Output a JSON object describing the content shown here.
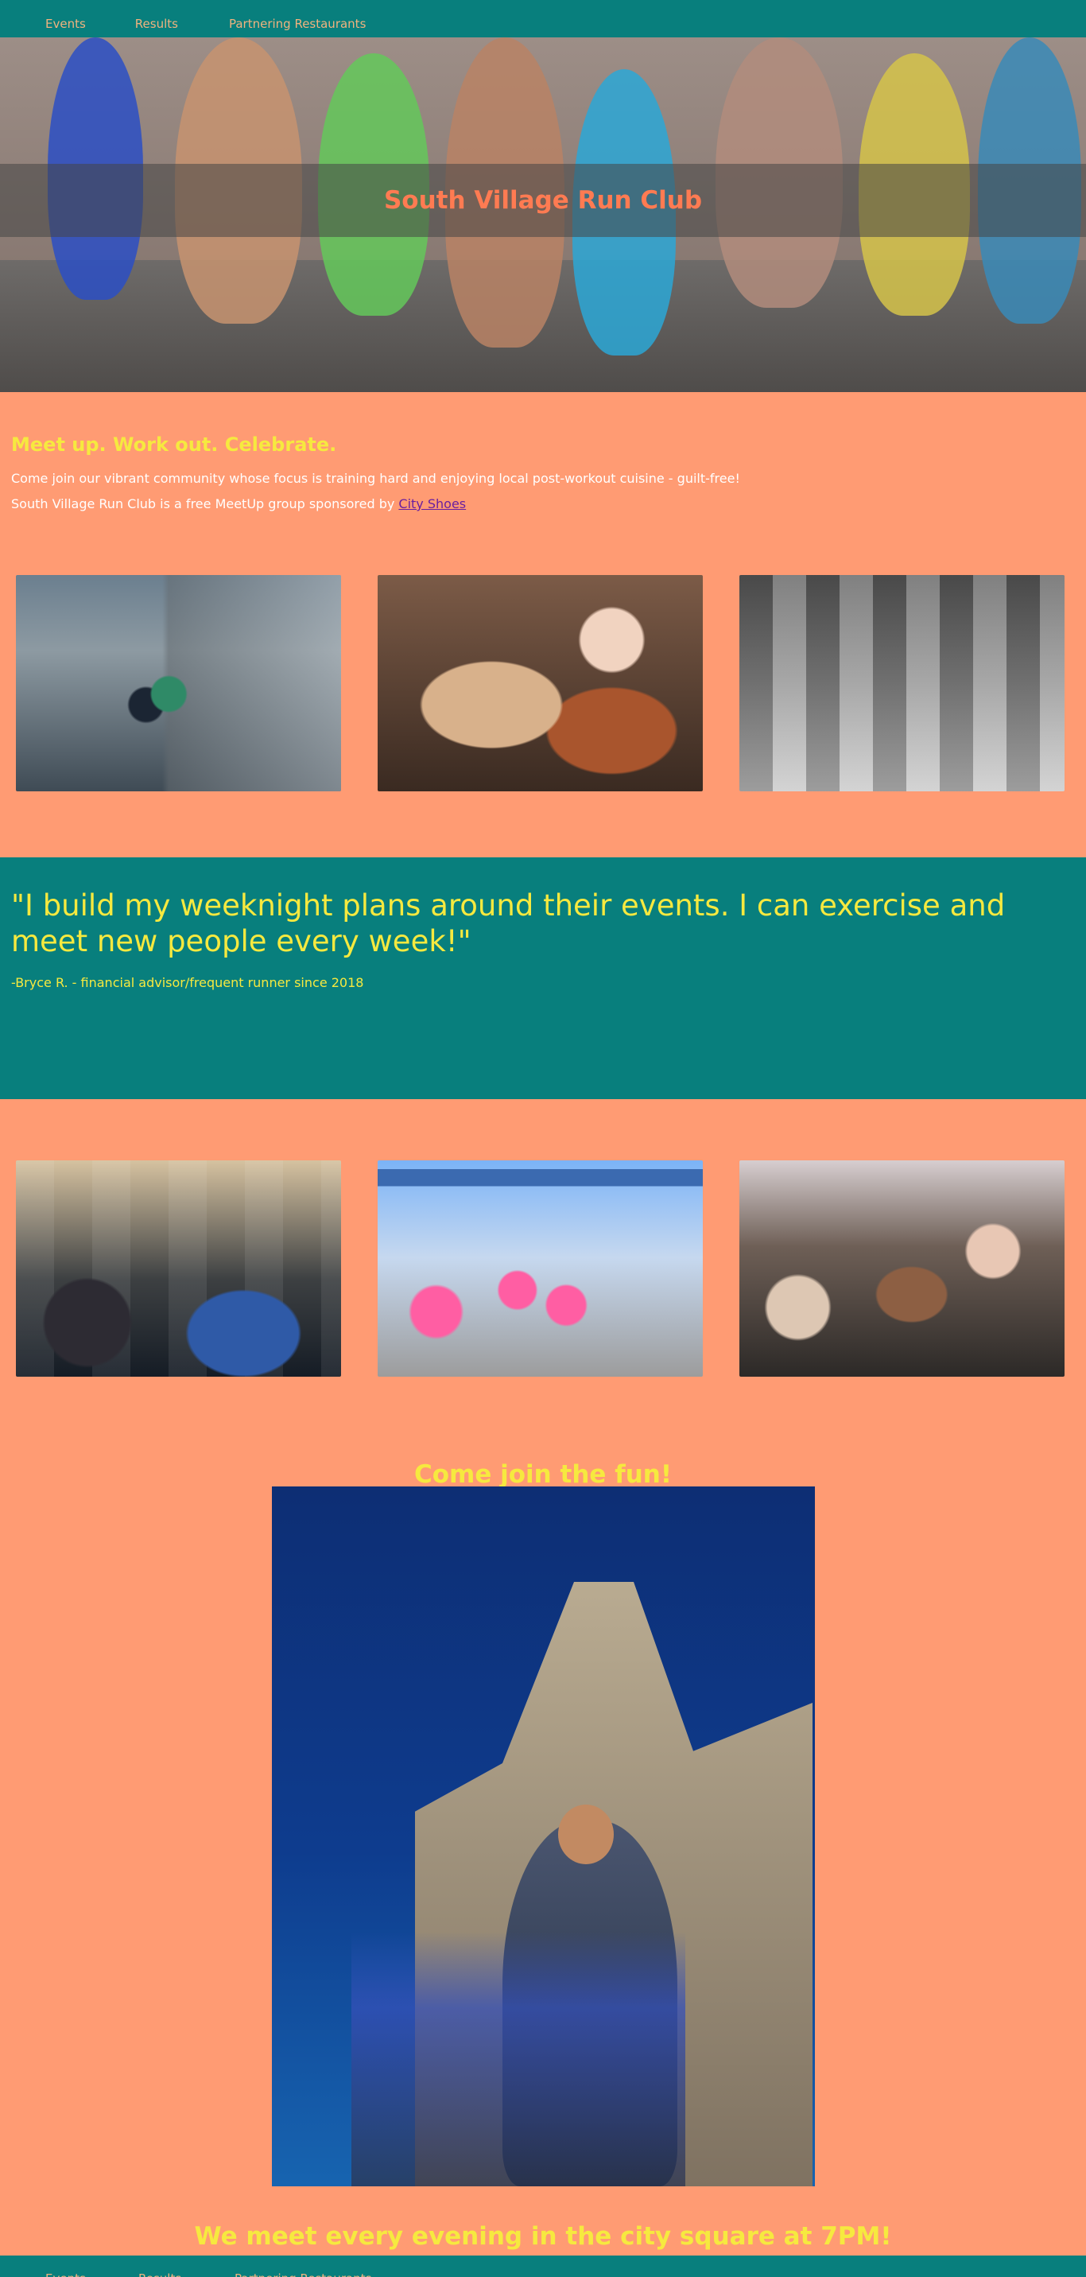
{
  "nav": {
    "items": [
      {
        "label": "Events"
      },
      {
        "label": "Results"
      },
      {
        "label": "Partnering Restaurants"
      }
    ]
  },
  "hero": {
    "title": "South Village Run Club",
    "image_icon": "runners-legs-photo"
  },
  "intro": {
    "heading": "Meet up. Work out. Celebrate.",
    "paragraph": "Come join our vibrant community whose focus is training hard and enjoying local post-workout cuisine - guilt-free!",
    "sponsor_prefix": "South Village Run Club is a free MeetUp group sponsored by ",
    "sponsor_link": "City Shoes"
  },
  "gallery_top": [
    {
      "name": "runners-street-photo"
    },
    {
      "name": "food-table-photo"
    },
    {
      "name": "marathon-runners-bw-photo"
    }
  ],
  "quote": {
    "text": "\"I build my weeknight plans around their events. I can exercise and meet new people every week!\"",
    "cite": "-Bryce R. - financial advisor/frequent runner since 2018"
  },
  "gallery_bottom": [
    {
      "name": "cafe-crowd-photo"
    },
    {
      "name": "rome-marathon-finish-photo"
    },
    {
      "name": "dinner-group-photo"
    }
  ],
  "join": {
    "heading": "Come join the fun!",
    "photo_icon": "cathedral-runners-photo"
  },
  "meet": {
    "text": "We meet every evening in the city square at 7PM!"
  },
  "colors": {
    "teal": "#087F7D",
    "salmon": "#FF9B73",
    "yellow": "#F6E93F",
    "orange_title": "#FF7B52",
    "nav_text": "#F0B37E"
  }
}
